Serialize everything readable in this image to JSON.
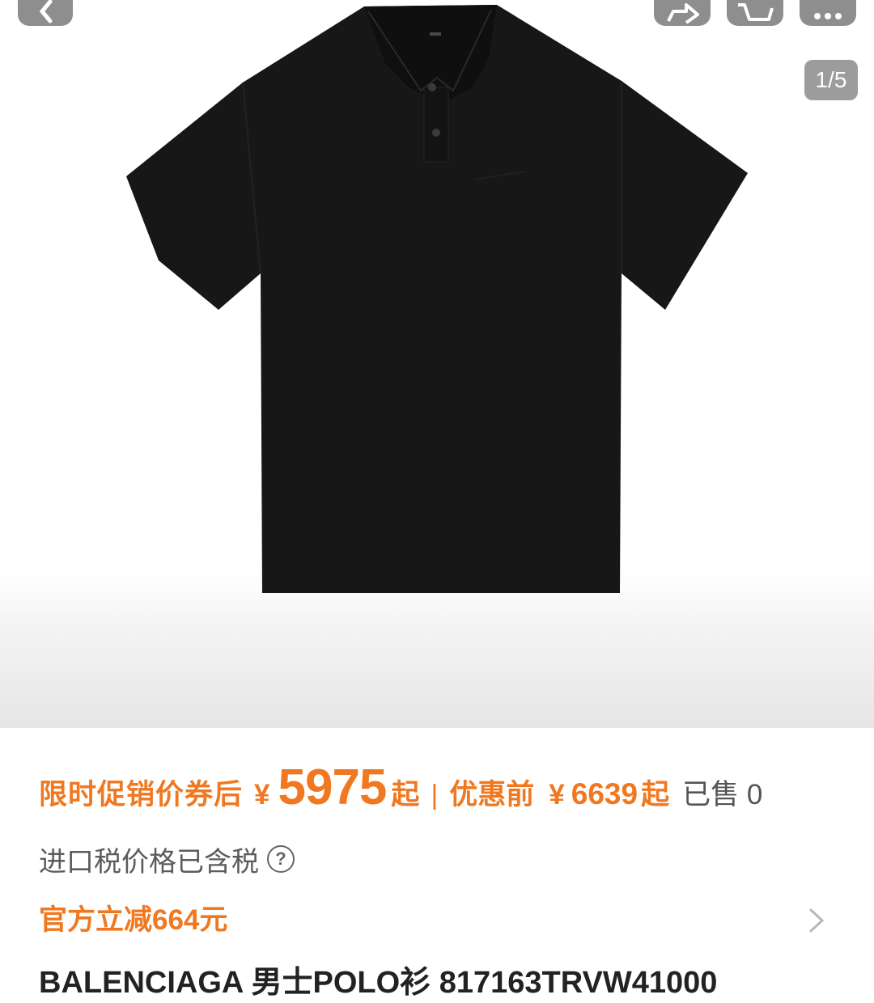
{
  "app": {
    "accent_color": "#f07820",
    "text_color": "#222222",
    "muted_color": "#5c5c5c"
  },
  "gallery": {
    "counter": "1/5",
    "image": "black short-sleeve polo shirt",
    "icons": [
      "back-icon",
      "share-icon",
      "cart-icon",
      "more-icon"
    ]
  },
  "price": {
    "label": "限时促销价券后",
    "currency": "¥",
    "value": "5975",
    "suffix": "起",
    "separator": "|",
    "original_label": "优惠前",
    "original_currency": "¥",
    "original_value": "6639",
    "original_suffix": "起",
    "sold": "已售 0"
  },
  "tax": {
    "text": "进口税价格已含税",
    "help_symbol": "?"
  },
  "promo": {
    "text": "官方立减664元"
  },
  "product": {
    "title": "BALENCIAGA 男士POLO衫 817163TRVW41000"
  }
}
